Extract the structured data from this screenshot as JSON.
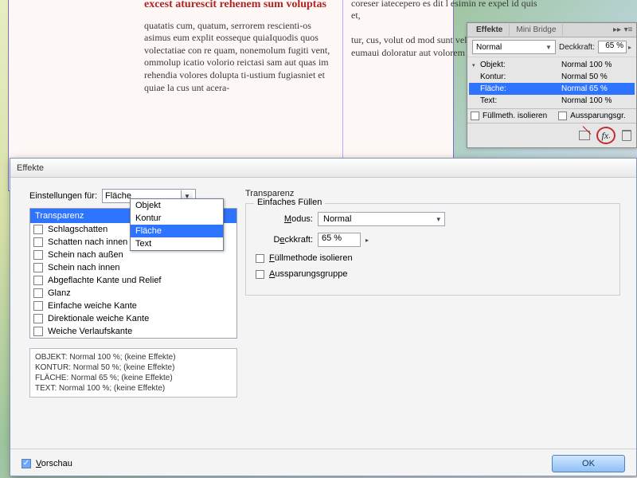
{
  "document": {
    "headline": "Atatem quatempossi ducilig natecte cus, excest aturescit rehenem sum voluptas",
    "body_left": "quatatis cum, quatum, serrorem rescienti-os asimus eum explit eosseque quiaIquodis quos volectatiae con re quam, nonemolum fugiti vent, ommolup icatio volorio reictasi sam aut quas im rehendia volores dolupta ti-ustium fugiasniet et quiae la cus unt acera-",
    "body_right": "Gatemque consequo tem maximin rero il inctius p coreser iatecepero es dit l esimin re expel id quis et,\n\ntur, cus, volut od mod sunt veleseq uatio. Nam eumaui doloratur aut volorem"
  },
  "panel": {
    "tabs": {
      "active": "Effekte",
      "inactive": "Mini Bridge"
    },
    "blend_mode": "Normal",
    "opacity_label": "Deckkraft:",
    "opacity_value": "65 %",
    "items": [
      {
        "name": "Objekt:",
        "value": "Normal 100 %",
        "tri": true,
        "sel": false
      },
      {
        "name": "Kontur:",
        "value": "Normal 50 %",
        "tri": false,
        "sel": false
      },
      {
        "name": "Fläche:",
        "value": "Normal 65 %",
        "tri": false,
        "sel": true
      },
      {
        "name": "Text:",
        "value": "Normal 100 %",
        "tri": false,
        "sel": false
      }
    ],
    "isolate_label": "Füllmeth. isolieren",
    "knockout_label": "Aussparungsgr.",
    "fx_label": "fx"
  },
  "dialog": {
    "title": "Effekte",
    "settings_for_label": "Einstellungen für:",
    "combo_value": "Fläche",
    "combo_options": [
      "Objekt",
      "Kontur",
      "Fläche",
      "Text"
    ],
    "combo_selected_index": 2,
    "effects": [
      "Transparenz",
      "Schlagschatten",
      "Schatten nach innen",
      "Schein nach außen",
      "Schein nach innen",
      "Abgeflachte Kante und Relief",
      "Glanz",
      "Einfache weiche Kante",
      "Direktionale weiche Kante",
      "Weiche Verlaufskante"
    ],
    "summary": [
      "OBJEKT: Normal 100 %; (keine Effekte)",
      "KONTUR: Normal 50 %; (keine Effekte)",
      "FLÄCHE: Normal 65 %; (keine Effekte)",
      "TEXT: Normal 100 %; (keine Effekte)"
    ],
    "right_title": "Transparenz",
    "fieldset_title": "Einfaches Füllen",
    "mode_label": "Modus:",
    "mode_value": "Normal",
    "opacity_label": "Deckkraft:",
    "opacity_value": "65 %",
    "isolate_label": "Füllmethode isolieren",
    "knockout_label": "Aussparungsgruppe",
    "preview_label": "Vorschau",
    "ok_label": "OK"
  }
}
